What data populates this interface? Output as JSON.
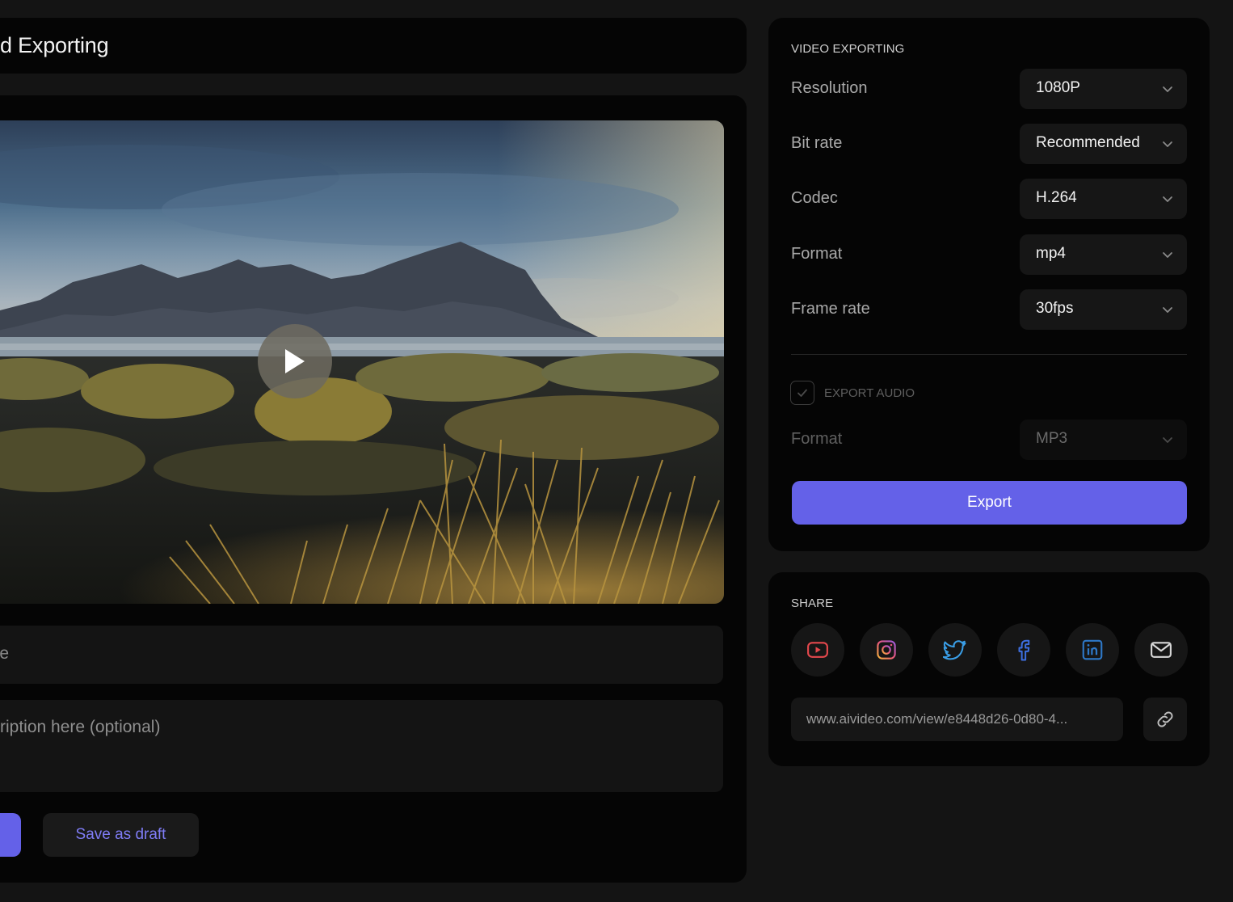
{
  "page": {
    "title": "d Exporting"
  },
  "editor": {
    "title_placeholder": "e",
    "description_placeholder": "ription here (optional)",
    "save_draft_label": "Save as draft",
    "play_icon": "play-icon"
  },
  "export": {
    "section_label": "VIDEO EXPORTING",
    "rows": [
      {
        "label": "Resolution",
        "value": "1080P"
      },
      {
        "label": "Bit rate",
        "value": "Recommended"
      },
      {
        "label": "Codec",
        "value": "H.264"
      },
      {
        "label": "Format",
        "value": "mp4"
      },
      {
        "label": "Frame rate",
        "value": "30fps"
      }
    ],
    "audio_label": "EXPORT AUDIO",
    "audio_checked": true,
    "audio_format_label": "Format",
    "audio_format_value": "MP3",
    "export_button": "Export",
    "accent_color": "#6461e8"
  },
  "share": {
    "section_label": "SHARE",
    "networks": [
      {
        "name": "youtube",
        "icon": "youtube-icon",
        "color": "#e5484d"
      },
      {
        "name": "instagram",
        "icon": "instagram-icon",
        "color": "#e8567c"
      },
      {
        "name": "twitter",
        "icon": "twitter-icon",
        "color": "#3a9fe8"
      },
      {
        "name": "facebook",
        "icon": "facebook-icon",
        "color": "#3d6fe0"
      },
      {
        "name": "linkedin",
        "icon": "linkedin-icon",
        "color": "#2e78c7"
      },
      {
        "name": "email",
        "icon": "mail-icon",
        "color": "#d8d8d8"
      }
    ],
    "url": "www.aivideo.com/view/e8448d26-0d80-4..."
  }
}
